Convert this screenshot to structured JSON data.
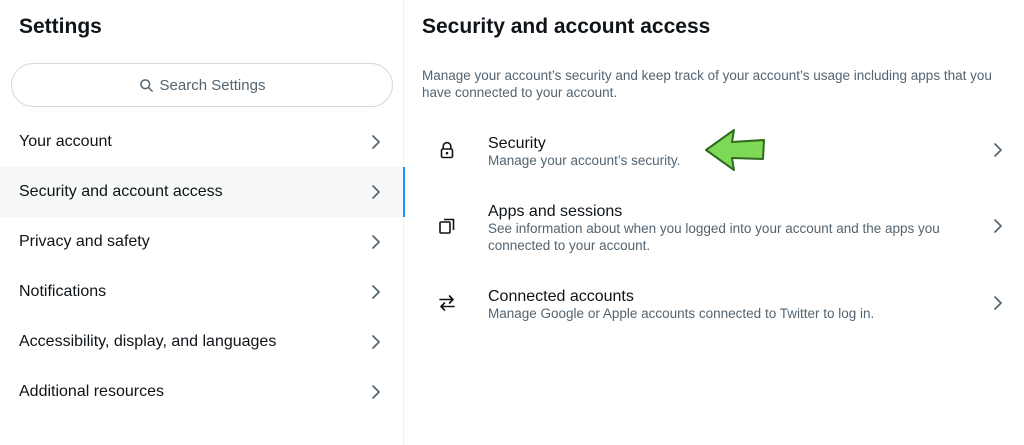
{
  "sidebar": {
    "title": "Settings",
    "search_placeholder": "Search Settings",
    "items": [
      {
        "label": "Your account",
        "active": false
      },
      {
        "label": "Security and account access",
        "active": true
      },
      {
        "label": "Privacy and safety",
        "active": false
      },
      {
        "label": "Notifications",
        "active": false
      },
      {
        "label": "Accessibility, display, and languages",
        "active": false
      },
      {
        "label": "Additional resources",
        "active": false
      }
    ]
  },
  "main": {
    "title": "Security and account access",
    "description": "Manage your account’s security and keep track of your account’s usage including apps that you have connected to your account.",
    "options": [
      {
        "title": "Security",
        "subtitle": "Manage your account’s security.",
        "icon": "lock-icon"
      },
      {
        "title": "Apps and sessions",
        "subtitle": "See information about when you logged into your account and the apps you connected to your account.",
        "icon": "copy-icon"
      },
      {
        "title": "Connected accounts",
        "subtitle": "Manage Google or Apple accounts connected to Twitter to log in.",
        "icon": "swap-arrows-icon"
      }
    ]
  },
  "annotation": {
    "icon": "green-pointer-arrow-icon",
    "color": "#7ed957"
  },
  "colors": {
    "accent": "#1d9bf0",
    "text": "#0f1419",
    "secondary": "#536471",
    "border": "#cfd9de",
    "active_bg": "#f7f9f9"
  }
}
